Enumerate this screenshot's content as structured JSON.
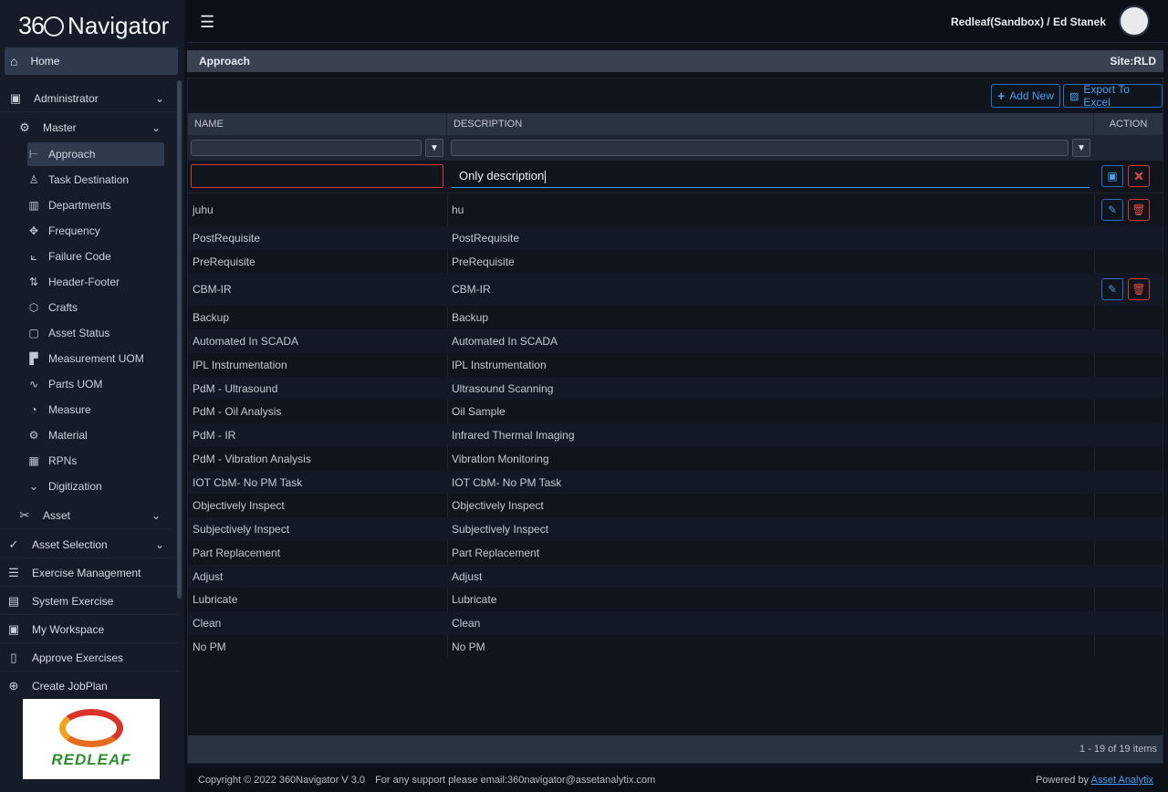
{
  "app": {
    "logo_prefix": "36",
    "logo_name": "Navigator"
  },
  "sidebar": {
    "home": "Home",
    "administrator": "Administrator",
    "master": "Master",
    "master_items": [
      {
        "label": "Approach",
        "icon": "signpost-icon"
      },
      {
        "label": "Task Destination",
        "icon": "user-icon"
      },
      {
        "label": "Departments",
        "icon": "layout-icon"
      },
      {
        "label": "Frequency",
        "icon": "arrows-icon"
      },
      {
        "label": "Failure Code",
        "icon": "chart-icon"
      },
      {
        "label": "Header-Footer",
        "icon": "sort-icon"
      },
      {
        "label": "Crafts",
        "icon": "box-icon"
      },
      {
        "label": "Asset Status",
        "icon": "note-icon"
      },
      {
        "label": "Measurement UOM",
        "icon": "ruler-icon"
      },
      {
        "label": "Parts UOM",
        "icon": "pulse-icon"
      },
      {
        "label": "Measure",
        "icon": "gauge-icon"
      },
      {
        "label": "Material",
        "icon": "gear-icon"
      },
      {
        "label": "RPNs",
        "icon": "calculator-icon"
      },
      {
        "label": "Digitization",
        "icon": "chevron-down-icon"
      }
    ],
    "asset": "Asset",
    "asset_selection": "Asset Selection",
    "exercise_management": "Exercise Management",
    "system_exercise": "System Exercise",
    "my_workspace": "My Workspace",
    "approve_exercises": "Approve Exercises",
    "create_jobplan": "Create JobPlan",
    "brand": "REDLEAF"
  },
  "header": {
    "user": "Redleaf(Sandbox) / Ed Stanek"
  },
  "breadcrumb": {
    "title": "Approach",
    "site": "Site:RLD"
  },
  "toolbar": {
    "add_new": "Add New",
    "export": "Export To Excel"
  },
  "table": {
    "columns": {
      "name": "NAME",
      "description": "DESCRIPTION",
      "action": "ACTION"
    },
    "edit_row": {
      "name": "",
      "description": "Only description"
    },
    "rows": [
      {
        "name": "juhu",
        "description": "hu"
      },
      {
        "name": "PostRequisite",
        "description": "PostRequisite"
      },
      {
        "name": "PreRequisite",
        "description": "PreRequisite"
      },
      {
        "name": "CBM-IR",
        "description": "CBM-IR"
      },
      {
        "name": "Backup",
        "description": "Backup"
      },
      {
        "name": "Automated In SCADA",
        "description": "Automated In SCADA"
      },
      {
        "name": "IPL Instrumentation",
        "description": "IPL Instrumentation"
      },
      {
        "name": "PdM - Ultrasound",
        "description": "Ultrasound Scanning"
      },
      {
        "name": "PdM - Oil Analysis",
        "description": "Oil Sample"
      },
      {
        "name": "PdM - IR",
        "description": "Infrared Thermal Imaging"
      },
      {
        "name": "PdM - Vibration Analysis",
        "description": "Vibration Monitoring"
      },
      {
        "name": "IOT CbM- No PM Task",
        "description": "IOT CbM- No PM Task"
      },
      {
        "name": "Objectively Inspect",
        "description": "Objectively Inspect"
      },
      {
        "name": "Subjectively Inspect",
        "description": "Subjectively Inspect"
      },
      {
        "name": "Part Replacement",
        "description": "Part Replacement"
      },
      {
        "name": "Adjust",
        "description": "Adjust"
      },
      {
        "name": "Lubricate",
        "description": "Lubricate"
      },
      {
        "name": "Clean",
        "description": "Clean"
      },
      {
        "name": "No PM",
        "description": "No PM"
      }
    ],
    "pager": "1 - 19 of 19 items"
  },
  "footer": {
    "copyright": "Copyright © 2022 360Navigator V 3.0",
    "support": "For any support please email:360navigator@assetanalytix.com",
    "powered_prefix": "Powered by",
    "powered_link": "Asset Analytix"
  },
  "colors": {
    "accent": "#4c9eea",
    "danger": "#e34c44",
    "sidebar_bg": "#151c28",
    "header_bg": "#2a3340"
  }
}
